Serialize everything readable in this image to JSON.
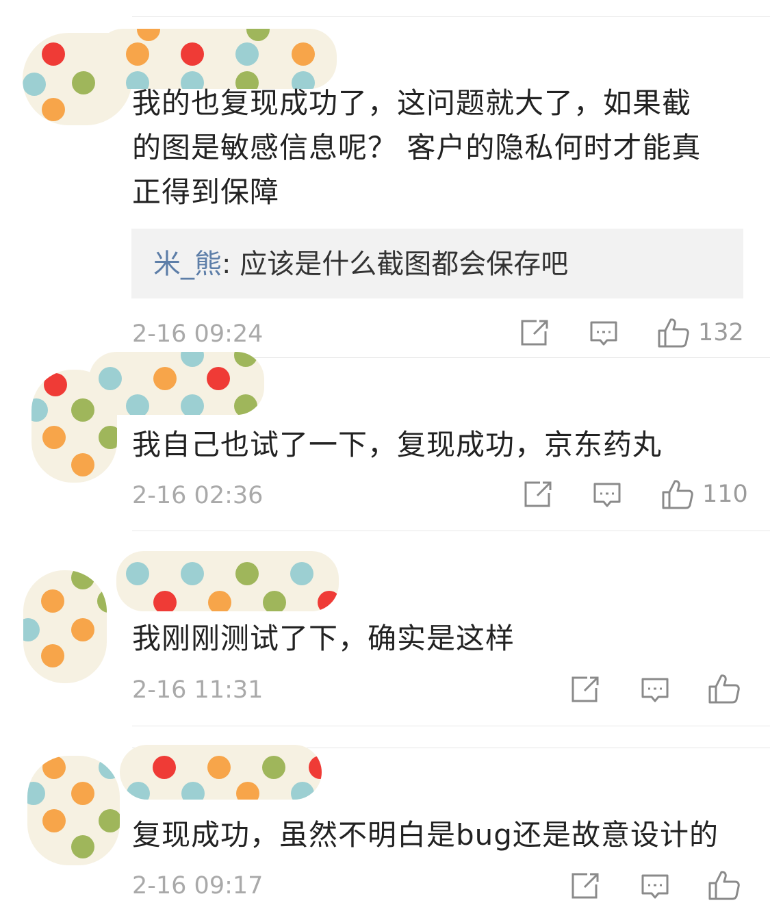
{
  "comments": [
    {
      "text_lines": [
        "我的也复现成功了，这问题就大了，如果截",
        "的图是敏感信息呢？ 客户的隐私何时才能真",
        "正得到保障"
      ],
      "reply": {
        "name": "米_熊",
        "sep": ": ",
        "text": "应该是什么截图都会保存吧"
      },
      "time": "2-16 09:24",
      "likes": "132"
    },
    {
      "text_lines": [
        "我自己也试了一下，复现成功，京东药丸"
      ],
      "time": "2-16 02:36",
      "likes": "110"
    },
    {
      "text_lines": [
        "我刚刚测试了下，确实是这样"
      ],
      "time": "2-16 11:31",
      "likes": ""
    },
    {
      "text_lines": [
        "复现成功，虽然不明白是bug还是故意设计的"
      ],
      "time": "2-16 09:17",
      "likes": ""
    }
  ],
  "icons": {
    "repost": "share-edit-icon",
    "comment": "comment-icon",
    "like": "thumbs-up-icon"
  },
  "colors": {
    "text": "#222222",
    "time": "#a9a9a9",
    "reply_name": "#5d7ea8",
    "reply_bg": "#f2f2f2",
    "dot_red": "#ef3b36",
    "dot_teal": "#9ccfd2",
    "dot_orange": "#f7a54a",
    "dot_green": "#9fb65b",
    "blob_bg": "#f6f1e2"
  }
}
